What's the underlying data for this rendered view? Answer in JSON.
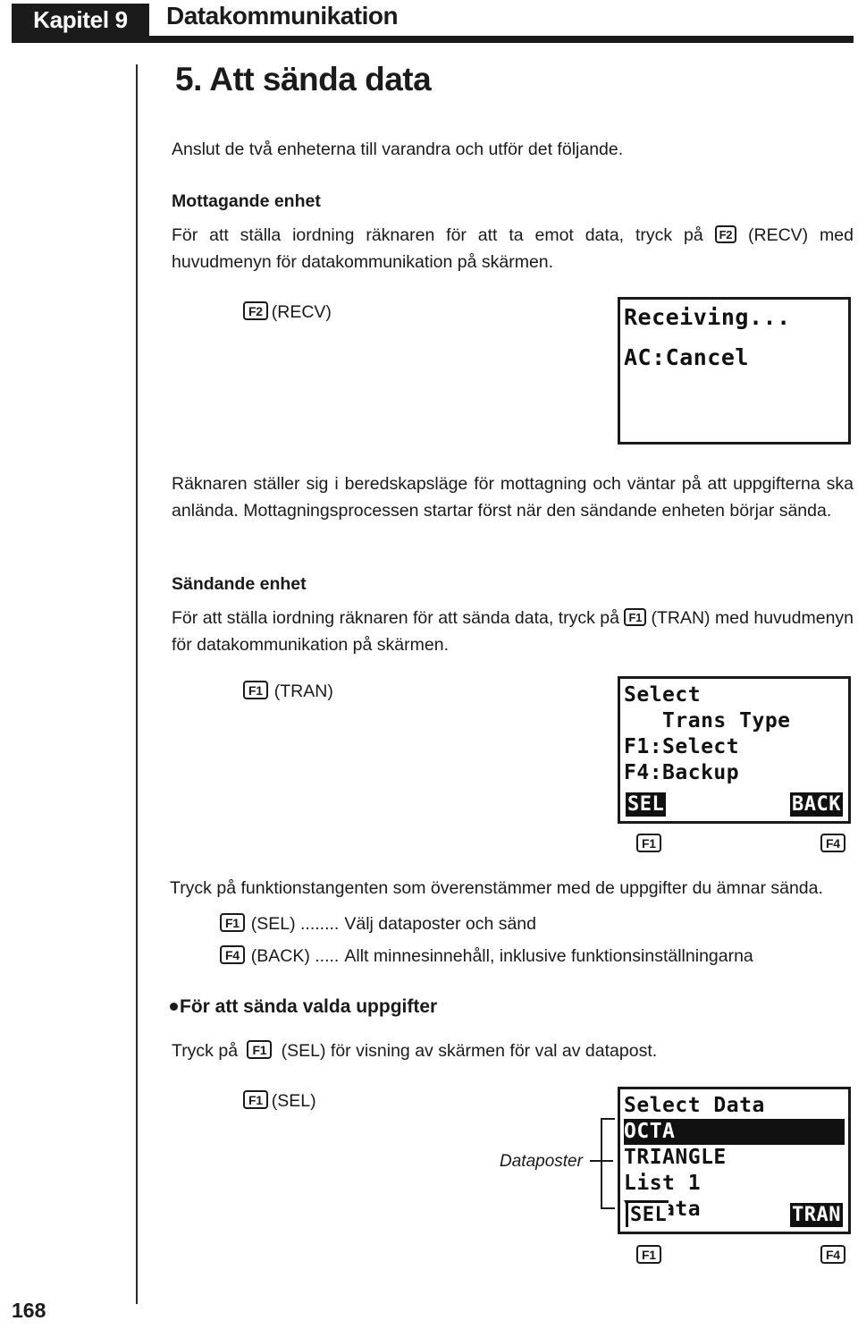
{
  "header": {
    "chapter_badge": "Kapitel 9",
    "chapter_title": "Datakommunikation"
  },
  "section": {
    "title": "5. Att sända data",
    "intro": "Anslut de två enheterna till varandra och utför det följande."
  },
  "receiving": {
    "heading": "Mottagande enhet",
    "body_before_key": "För att ställa iordning räknaren för att ta emot data, tryck på",
    "key": "F2",
    "body_after_key": "(RECV) med huvudmenyn för datakommunikation på skärmen.",
    "caption_key": "F2",
    "caption_text": "(RECV)",
    "screen": {
      "line1": "Receiving...",
      "line2": "AC:Cancel"
    },
    "note": "Räknaren ställer sig i beredskapsläge för mottagning och väntar på att uppgifterna ska anlända. Mottagningsprocessen startar först när den sändande enheten börjar sända."
  },
  "sending": {
    "heading": "Sändande enhet",
    "body_before_key": "För att ställa iordning räknaren för att sända data, tryck på",
    "key": "F1",
    "body_after_key": "(TRAN) med huvudmenyn för datakommunikation på skärmen.",
    "caption_key": "F1",
    "caption_text": "(TRAN)",
    "screen": {
      "line1": "Select",
      "line2": "   Trans Type",
      "line3": "F1:Select",
      "line4": "F4:Backup",
      "tab_left": "SEL",
      "tab_right": "BACK"
    },
    "fkey_left": "F1",
    "fkey_right": "F4",
    "instruction": "Tryck på funktionstangenten som överenstämmer med de uppgifter du ämnar sända.",
    "options": [
      {
        "key": "F1",
        "label": "(SEL) ........",
        "desc": "Välj dataposter och sänd"
      },
      {
        "key": "F4",
        "label": "(BACK) .....",
        "desc": "Allt minnesinnehåll, inklusive funktionsinställningarna"
      }
    ]
  },
  "selected": {
    "bullet_heading": "För att sända valda uppgifter",
    "body_before_key": "Tryck på",
    "key": "F1",
    "body_after_key": "(SEL) för visning av skärmen för val av datapost.",
    "caption_key": "F1",
    "caption_text": "(SEL)",
    "bracket_label": "Dataposter",
    "screen": {
      "title": "Select Data",
      "rows": [
        "OCTA",
        "TRIANGLE",
        "List 1",
        "Y=Data"
      ],
      "highlighted_index": 0,
      "tab_left": "SEL",
      "tab_right": "TRAN"
    },
    "fkey_left": "F1",
    "fkey_right": "F4"
  },
  "footer": {
    "page_number": "168"
  },
  "colors": {
    "ink": "#1a1a1a",
    "paper": "#ffffff",
    "badge_bg": "#1b1b1b",
    "badge_fg": "#ffffff"
  }
}
